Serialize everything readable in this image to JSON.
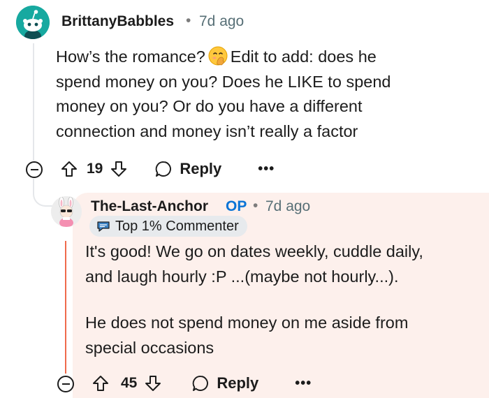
{
  "comment": {
    "author": "BrittanyBabbles",
    "separator": "•",
    "time": "7d ago",
    "avatar_icon": "reddit-snoo-avatar-teal",
    "body_lines": [
      "How’s the romance?",
      "Edit to add: does he",
      "spend money on you? Does he LIKE to spend",
      "money on you? Or do you have a different",
      "connection and money isn’t really a factor"
    ],
    "emoji": "face-with-hand-over-mouth",
    "actions": {
      "collapse_icon": "collapse-minus-icon",
      "upvote_icon": "upvote-arrow-icon",
      "score": "19",
      "downvote_icon": "downvote-arrow-icon",
      "reply_icon": "speech-bubble-icon",
      "reply_label": "Reply",
      "more_label": "•••"
    }
  },
  "reply": {
    "author": "The-Last-Anchor",
    "op_label": "OP",
    "separator": "•",
    "time": "7d ago",
    "avatar_icon": "bunny-avatar",
    "badge_icon": "commenter-badge-icon",
    "badge_label": "Top 1% Commenter",
    "paragraphs": [
      [
        "It's good! We go on dates weekly, cuddle daily,",
        "and laugh hourly :P ...(maybe not hourly...)."
      ],
      [
        "He does not spend money on me aside from",
        "special occasions"
      ]
    ],
    "actions": {
      "collapse_icon": "collapse-minus-icon",
      "upvote_icon": "upvote-arrow-icon",
      "score": "45",
      "downvote_icon": "downvote-arrow-icon",
      "reply_icon": "speech-bubble-icon",
      "reply_label": "Reply",
      "more_label": "•••"
    }
  },
  "colors": {
    "op_accent": "#ef6a4c",
    "op_label": "#0a74d6",
    "op_background": "#fdf0ec",
    "avatar_teal": "#17a9a0",
    "meta_gray": "#576f76"
  }
}
